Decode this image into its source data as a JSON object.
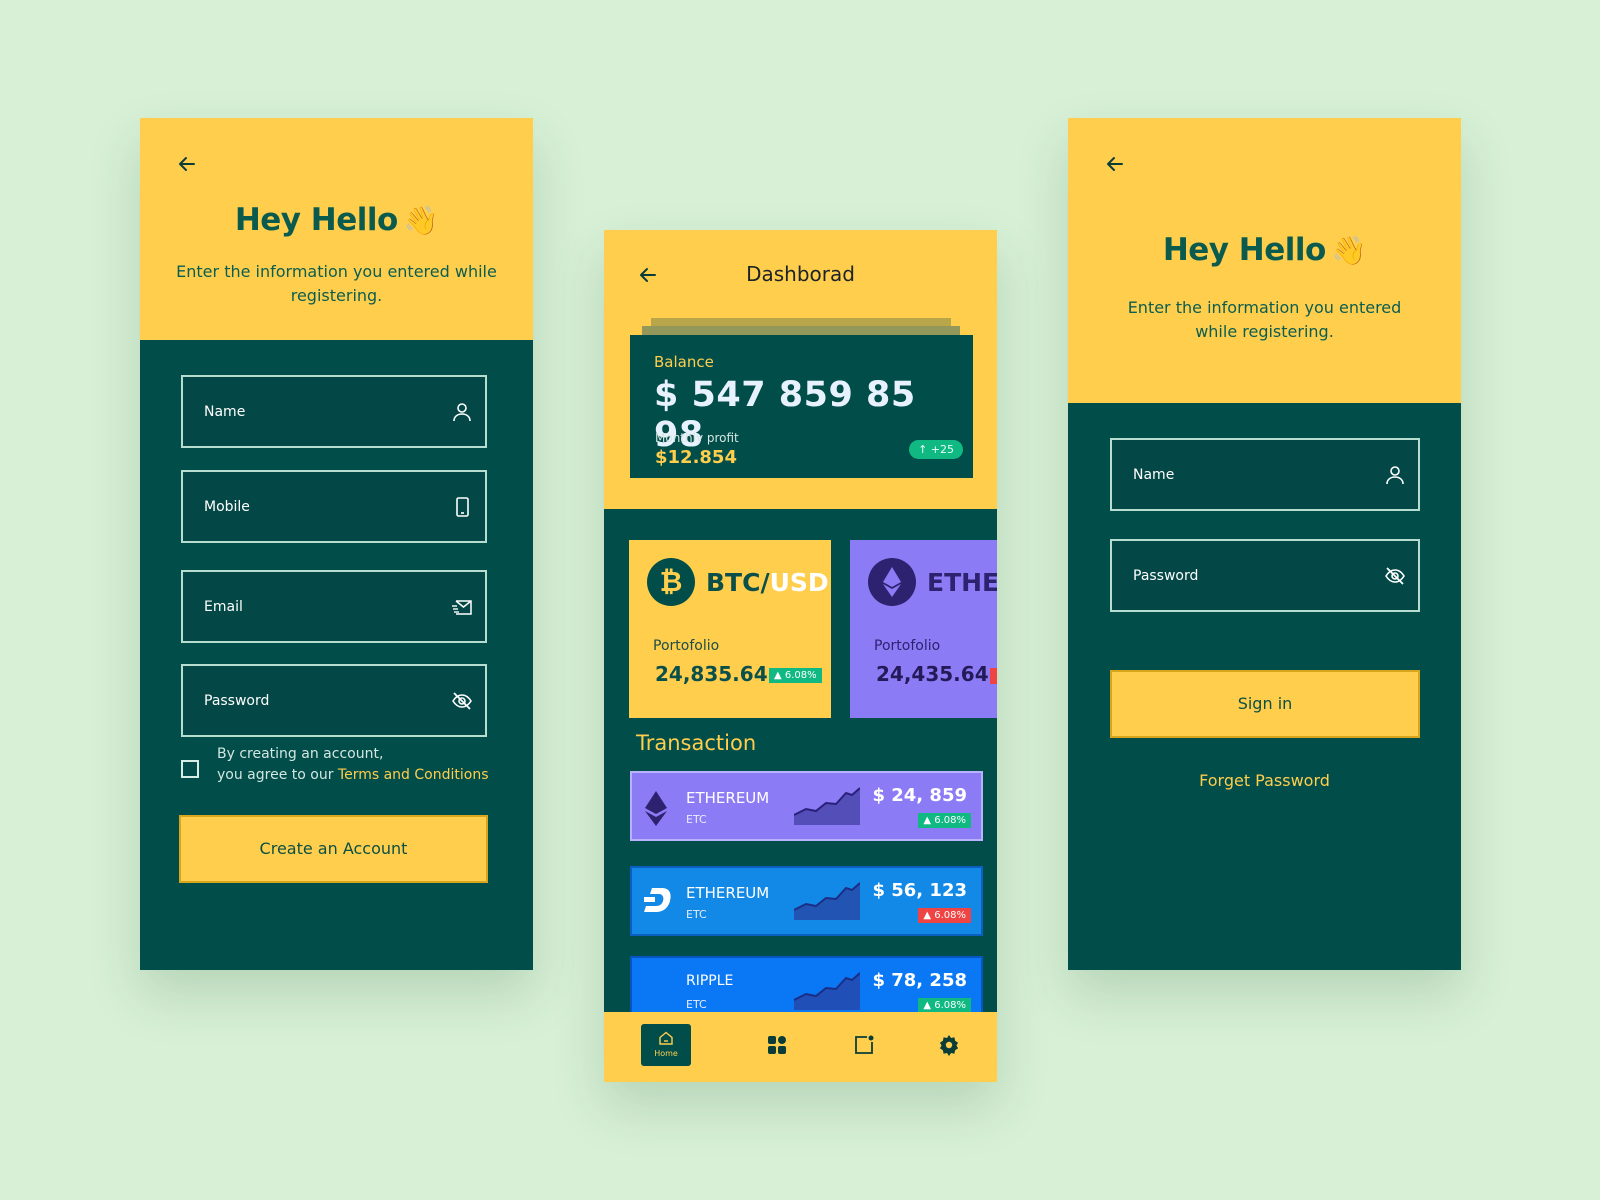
{
  "register": {
    "title": "Hey Hello",
    "subtitle_line1": "Enter the information you entered while",
    "subtitle_line2": "registering.",
    "fields": {
      "name": "Name",
      "mobile": "Mobile",
      "email": "Email",
      "password": "Password"
    },
    "terms_line1": "By creating an account,",
    "terms_line2": "you agree to our ",
    "terms_link": "Terms and Conditions",
    "cta": "Create an Account"
  },
  "dashboard": {
    "title": "Dashborad",
    "balance_label": "Balance",
    "balance_value": "$ 547 859 85 98",
    "profit_label": "Monthly profit",
    "profit_value": "$12.854",
    "profit_change": "+25",
    "coins": [
      {
        "pair_base": "BTC/",
        "pair_quote": "USD",
        "portfolio_label": "Portofolio",
        "portfolio_value": "24,835.64",
        "change": "6.08%"
      },
      {
        "pair_base": "ETHER",
        "pair_quote": "",
        "portfolio_label": "Portofolio",
        "portfolio_value": "24,435.64",
        "change": ""
      }
    ],
    "transaction_title": "Transaction",
    "transactions": [
      {
        "name": "ETHEREUM",
        "sub": "ETC",
        "amount": "$ 24, 859",
        "change": "6.08%"
      },
      {
        "name": "ETHEREUM",
        "sub": "ETC",
        "amount": "$ 56, 123",
        "change": "6.08%"
      },
      {
        "name": "RIPPLE",
        "sub": "ETC",
        "amount": "$ 78, 258",
        "change": "6.08%"
      }
    ],
    "nav": {
      "home": "Home"
    }
  },
  "signin": {
    "title": "Hey Hello",
    "subtitle_line1": "Enter the information you entered",
    "subtitle_line2": "while registering.",
    "fields": {
      "name": "Name",
      "password": "Password"
    },
    "cta": "Sign in",
    "forgot": "Forget Password"
  },
  "colors": {
    "bg": "#d7f0d6",
    "yellow": "#ffce4d",
    "teal": "#004d4a",
    "purple": "#8b7cf6",
    "blue": "#1289e6",
    "green": "#10b981",
    "red": "#ef4444"
  }
}
